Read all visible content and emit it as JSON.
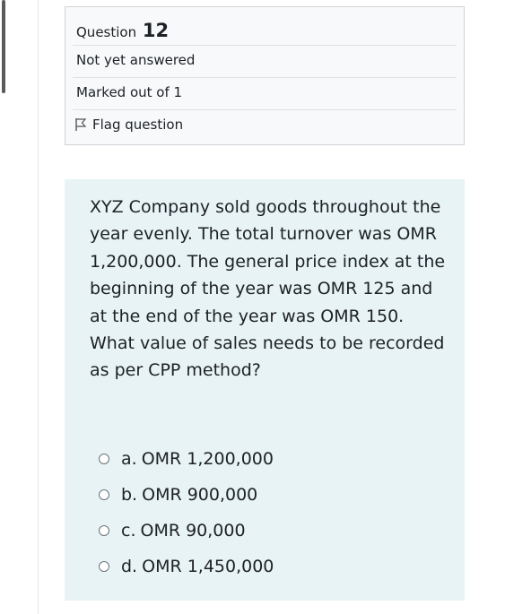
{
  "question_info": {
    "question_label": "Question",
    "question_number": "12",
    "state": "Not yet answered",
    "grade": "Marked out of 1",
    "flag_label": "Flag question"
  },
  "question": {
    "text": "XYZ Company sold goods throughout the year evenly. The total turnover was OMR 1,200,000. The general price index at the beginning of the year was OMR 125 and at the end of the year was OMR 150. What value of sales needs to be recorded as per CPP method?",
    "answers": [
      {
        "letter": "a.",
        "text": "OMR 1,200,000"
      },
      {
        "letter": "b.",
        "text": "OMR 900,000"
      },
      {
        "letter": "c.",
        "text": "OMR 90,000"
      },
      {
        "letter": "d.",
        "text": "OMR 1,450,000"
      }
    ]
  },
  "colors": {
    "info_bg": "#f8f9fa",
    "question_bg": "#e7f3f5",
    "text": "#1d2125"
  }
}
